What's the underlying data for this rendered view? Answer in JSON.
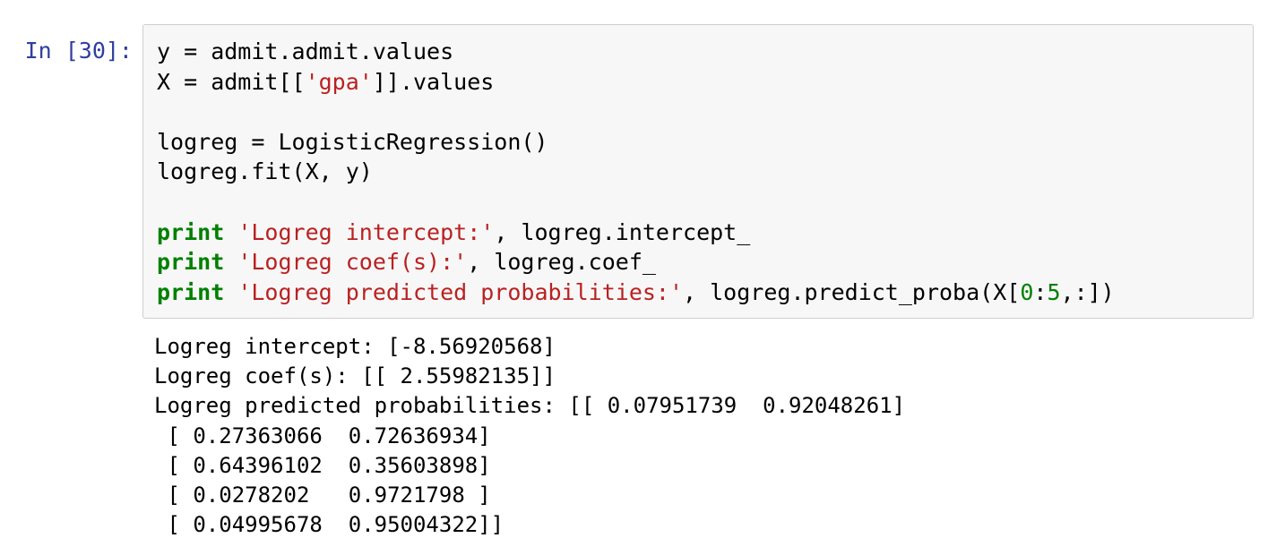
{
  "cell": {
    "prompt": "In [30]:",
    "code_lines": [
      [
        {
          "t": "y = admit.admit.values",
          "c": "plain"
        }
      ],
      [
        {
          "t": "X = admit[[",
          "c": "plain"
        },
        {
          "t": "'gpa'",
          "c": "str"
        },
        {
          "t": "]].values",
          "c": "plain"
        }
      ],
      [
        {
          "t": "",
          "c": "plain"
        }
      ],
      [
        {
          "t": "logreg = LogisticRegression()",
          "c": "plain"
        }
      ],
      [
        {
          "t": "logreg.fit(X, y)",
          "c": "plain"
        }
      ],
      [
        {
          "t": "",
          "c": "plain"
        }
      ],
      [
        {
          "t": "print",
          "c": "kw"
        },
        {
          "t": " ",
          "c": "plain"
        },
        {
          "t": "'Logreg intercept:'",
          "c": "str"
        },
        {
          "t": ", logreg.intercept_",
          "c": "plain"
        }
      ],
      [
        {
          "t": "print",
          "c": "kw"
        },
        {
          "t": " ",
          "c": "plain"
        },
        {
          "t": "'Logreg coef(s):'",
          "c": "str"
        },
        {
          "t": ", logreg.coef_",
          "c": "plain"
        }
      ],
      [
        {
          "t": "print",
          "c": "kw"
        },
        {
          "t": " ",
          "c": "plain"
        },
        {
          "t": "'Logreg predicted probabilities:'",
          "c": "str"
        },
        {
          "t": ", logreg.predict_proba(X[",
          "c": "plain"
        },
        {
          "t": "0",
          "c": "num"
        },
        {
          "t": ":",
          "c": "plain"
        },
        {
          "t": "5",
          "c": "num"
        },
        {
          "t": ",:])",
          "c": "plain"
        }
      ]
    ],
    "output_lines": [
      "Logreg intercept: [-8.56920568]",
      "Logreg coef(s): [[ 2.55982135]]",
      "Logreg predicted probabilities: [[ 0.07951739  0.92048261]",
      " [ 0.27363066  0.72636934]",
      " [ 0.64396102  0.35603898]",
      " [ 0.0278202   0.9721798 ]",
      " [ 0.04995678  0.95004322]]"
    ]
  },
  "colors": {
    "prompt": "#303F9F",
    "keyword": "#008000",
    "string": "#BA2121",
    "number": "#008000",
    "input_background": "#f7f7f7",
    "input_border": "#cfcfcf"
  }
}
